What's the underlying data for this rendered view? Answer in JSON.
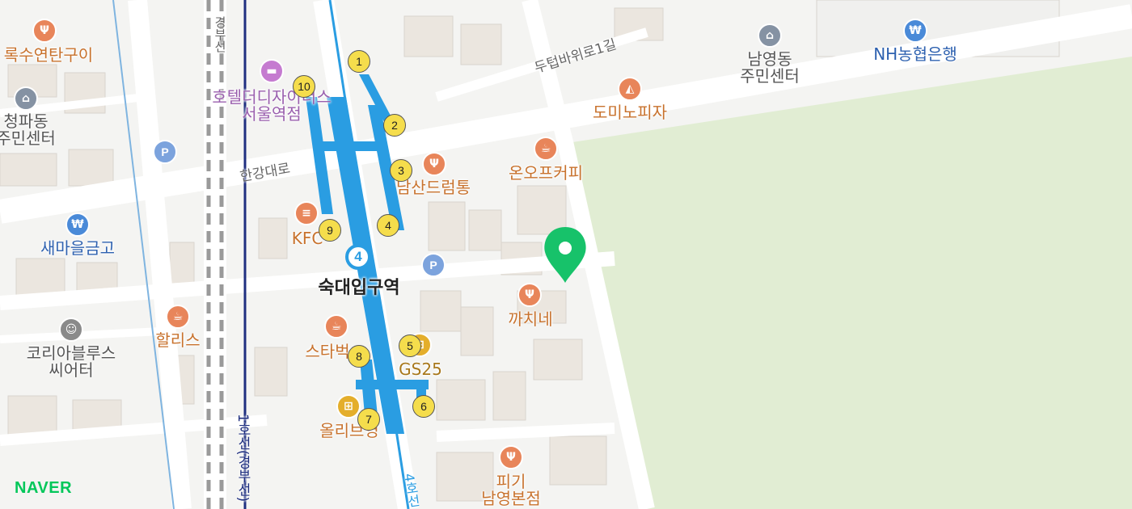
{
  "map": {
    "station_name": "숙대입구역",
    "line_number": "4",
    "exits": [
      "1",
      "2",
      "3",
      "4",
      "5",
      "6",
      "7",
      "8",
      "9",
      "10"
    ],
    "roads": {
      "hangang": "한강대로",
      "dutteop": "두텁바위로1길",
      "gyeongbu": "경부선",
      "line1": "1호선(경부선)",
      "line4": "4호선"
    },
    "pois": {
      "rogsu": "록수연탄구이",
      "cheongpa": "청파동\n주민센터",
      "saemaeul": "새마을금고",
      "hollys": "할리스",
      "korea_blues": "코리아블루스\n씨어터",
      "hotel": "호텔더디자이너스\n서울역점",
      "kfc": "KFC",
      "starbucks": "스타벅",
      "oliveyoung": "올리브영",
      "gs25": "GS25",
      "namsan": "남산드럼통",
      "onof": "온오프커피",
      "kkachi": "까치네",
      "pigi": "피기\n남영본점",
      "domino": "도미노피자",
      "namyeong": "남영동\n주민센터",
      "nh": "NH농협은행"
    },
    "colors": {
      "subway_line4": "#2a9de2",
      "park": "#e1edd3",
      "marker": "#17c26a"
    },
    "logo": "NAVER"
  }
}
